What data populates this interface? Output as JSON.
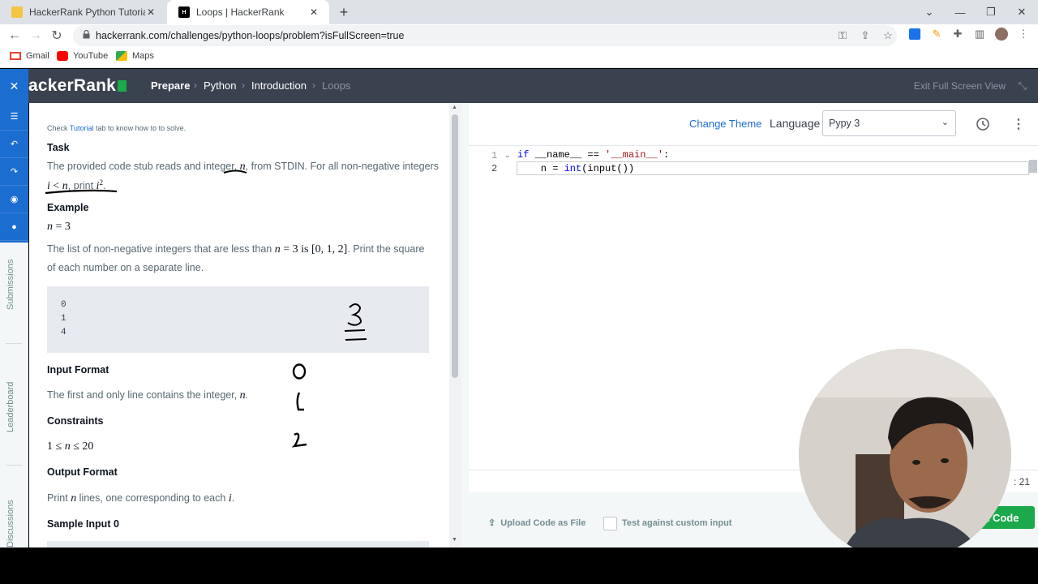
{
  "browser": {
    "tabs": [
      {
        "title": "HackerRank Python Tutorial - Pyt",
        "active": false
      },
      {
        "title": "Loops | HackerRank",
        "active": true
      }
    ],
    "url": "hackerrank.com/challenges/python-loops/problem?isFullScreen=true",
    "bookmarks": [
      "Gmail",
      "YouTube",
      "Maps"
    ],
    "colors": {
      "tabbar": "#dee1e6",
      "omnibox": "#f1f3f4"
    }
  },
  "hackerrank": {
    "logo": "ackerRank",
    "breadcrumbs": [
      "Prepare",
      "Python",
      "Introduction",
      "Loops"
    ],
    "separator": "›",
    "exit_fullscreen": "Exit Full Screen View",
    "brand_color": "#1ba94c",
    "accent": "#1c6dd0"
  },
  "rail": {
    "vertical_labels": [
      "Submissions",
      "Leaderboard",
      "Discussions"
    ]
  },
  "problem": {
    "hint_pre": "Check ",
    "hint_link": "Tutorial",
    "hint_post": " tab to know how to to solve.",
    "task_heading": "Task",
    "task_line1_pre": "The provided code stub reads and integer, ",
    "task_line1_var": "n",
    "task_line1_post": ", from STDIN. For all non-negative integers",
    "task_line2_i": "i",
    "task_line2_lt": " < ",
    "task_line2_n": "n",
    "task_line2_mid": ", print ",
    "task_line2_i2": "i",
    "task_line2_sup": "2",
    "task_line2_end": ".",
    "example_heading": "Example",
    "example_eq_n": "n",
    "example_eq_rest": " = 3",
    "example_text1_pre": "The list of non-negative integers that are less than ",
    "example_text1_n": "n",
    "example_text1_mid": " = 3 is ",
    "example_text1_list": "[0, 1, 2]",
    "example_text1_post": ". Print the square",
    "example_text2": "of each number on a separate line.",
    "code_lines": [
      "0",
      "1",
      "4"
    ],
    "input_heading": "Input Format",
    "input_text_pre": "The first and only line contains the integer, ",
    "input_text_n": "n",
    "input_text_post": ".",
    "constraints_heading": "Constraints",
    "constraint_pre": "1 ≤ ",
    "constraint_n": "n",
    "constraint_post": " ≤ 20",
    "output_heading": "Output Format",
    "output_text_pre": "Print ",
    "output_text_n": "n",
    "output_text_mid": " lines, one corresponding to each ",
    "output_text_i": "i",
    "output_text_post": ".",
    "sample_heading": "Sample Input 0"
  },
  "editor": {
    "change_theme": "Change Theme",
    "language_label": "Language",
    "language_value": "Pypy 3",
    "line_numbers": [
      "1",
      "2"
    ],
    "line1_kw": "if",
    "line1_rest": " __name__ == ",
    "line1_str": "'__main__'",
    "line1_end": ":",
    "line2_indent": "    n = ",
    "line2_fn": "int",
    "line2_rest": "(input())",
    "cursor_pos": ": 21",
    "upload_label": "Upload Code as File",
    "custom_input_label": "Test against custom input",
    "submit_label": "t Code"
  }
}
